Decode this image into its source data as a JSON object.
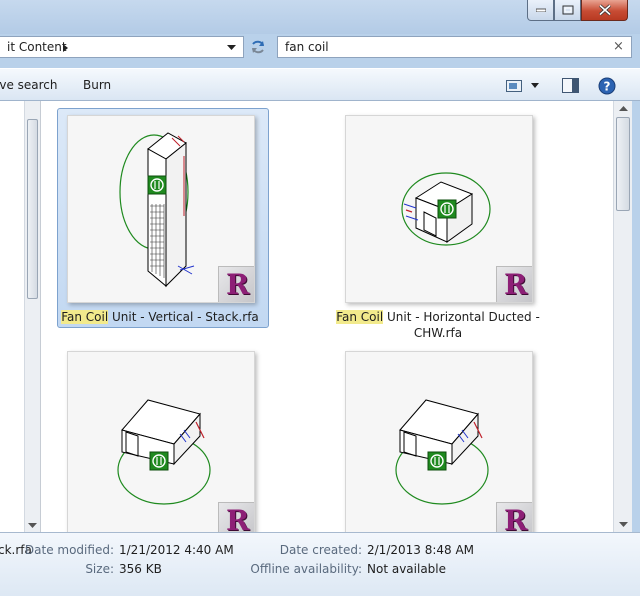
{
  "address": {
    "path": "it Content"
  },
  "search": {
    "value": "fan coil",
    "clear": "×"
  },
  "commands": {
    "save_search": "ave search",
    "burn": "Burn"
  },
  "files": [
    {
      "highlight": "Fan Coil",
      "name_line1": " Unit - Vertical - Stack.rfa",
      "name_line2": "",
      "selected": true
    },
    {
      "highlight": "Fan Coil",
      "name_line1": " Unit - Horizontal Ducted -",
      "name_line2": "CHW.rfa",
      "selected": false
    },
    {
      "highlight": "",
      "name_line1": "",
      "name_line2": "",
      "selected": false
    },
    {
      "highlight": "",
      "name_line1": "",
      "name_line2": "",
      "selected": false
    }
  ],
  "revit_badge": "R",
  "details": {
    "filename": "ck.rfa",
    "date_modified_label": "Date modified:",
    "date_modified": "1/21/2012 4:40 AM",
    "size_label": "Size:",
    "size": "356 KB",
    "date_created_label": "Date created:",
    "date_created": "2/1/2013 8:48 AM",
    "offline_label": "Offline availability:",
    "offline": "Not available"
  },
  "icons": [
    "minimize-icon",
    "maximize-icon",
    "close-icon",
    "chevron-right-icon",
    "chevron-down-icon",
    "refresh-icon",
    "clear-icon",
    "view-icon",
    "preview-pane-icon",
    "help-icon"
  ],
  "colors": {
    "highlight": "#f2ea8c",
    "selection": "#c2d8f2",
    "revit": "#8d1f76",
    "cad_green": "#1f8a1f"
  }
}
